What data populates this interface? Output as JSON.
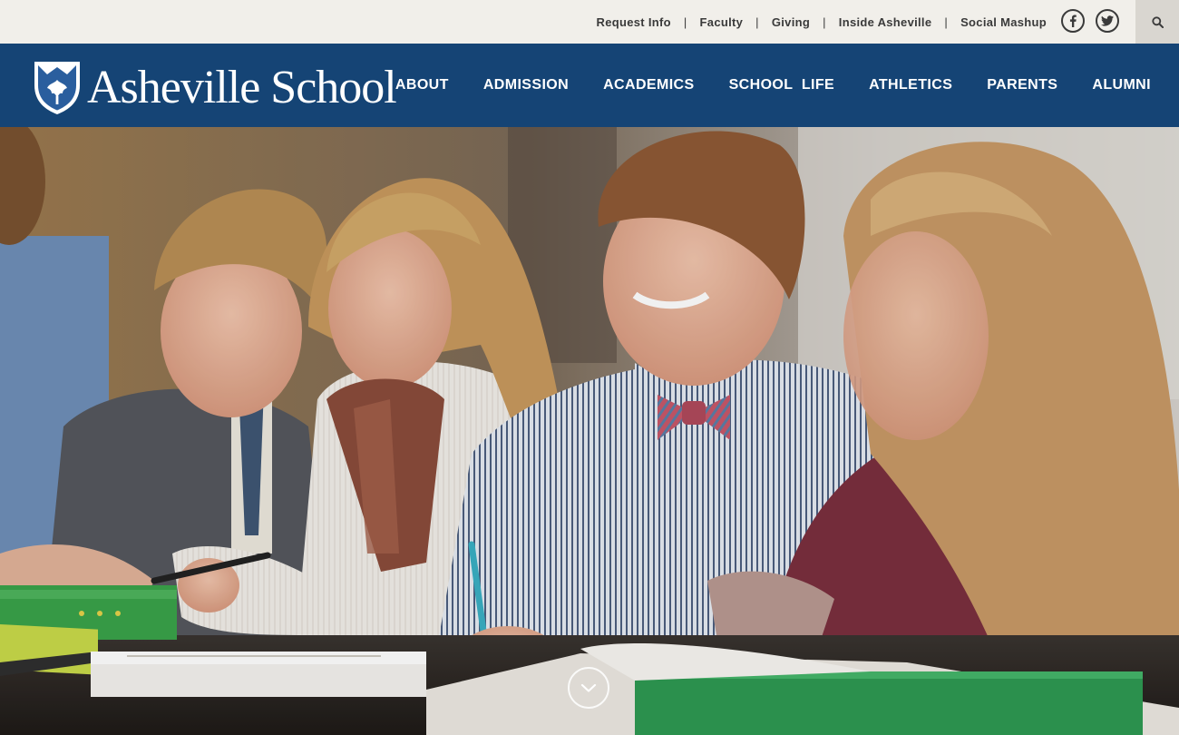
{
  "utility": {
    "links": [
      "Request Info",
      "Faculty",
      "Giving",
      "Inside Asheville",
      "Social Mashup"
    ],
    "separator": "|",
    "facebook_icon": "facebook-icon",
    "twitter_icon": "twitter-icon",
    "search_icon": "search-icon"
  },
  "brand": {
    "name": "Asheville School",
    "crest_icon": "shield-crest-icon"
  },
  "nav": {
    "items": [
      "ABOUT",
      "ADMISSION",
      "ACADEMICS",
      "SCHOOL  LIFE",
      "ATHLETICS",
      "PARENTS",
      "ALUMNI"
    ]
  },
  "hero": {
    "scroll_icon": "chevron-down-icon"
  },
  "colors": {
    "utility_bg": "#f1efea",
    "nav_bg": "#14467d",
    "text_dark": "#3a3a3a",
    "white": "#ffffff"
  }
}
